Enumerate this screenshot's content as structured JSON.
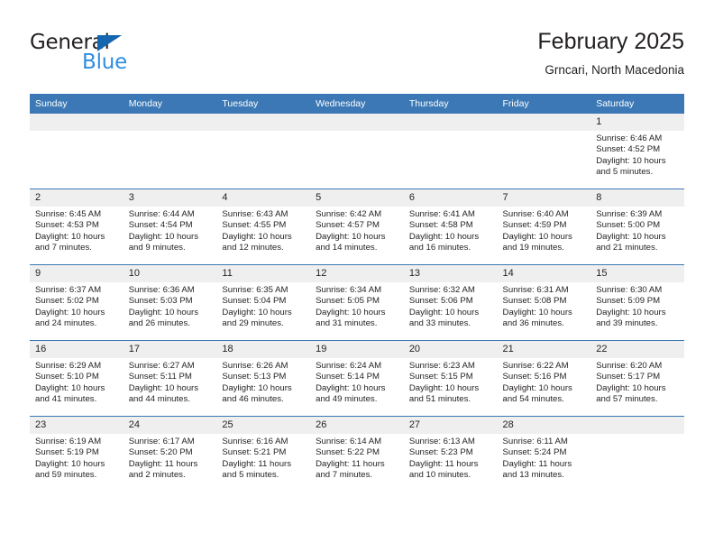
{
  "brand": {
    "name_top": "General",
    "name_bottom": "Blue",
    "accent_color": "#2e8ddf",
    "triangle_color": "#1466b0"
  },
  "header": {
    "title": "February 2025",
    "subtitle": "Grncari, North Macedonia",
    "header_bg": "#3b78b5",
    "daynum_bg": "#efefef"
  },
  "weekday_headers": [
    "Sunday",
    "Monday",
    "Tuesday",
    "Wednesday",
    "Thursday",
    "Friday",
    "Saturday"
  ],
  "labels": {
    "sunrise_prefix": "Sunrise:",
    "sunset_prefix": "Sunset:",
    "daylight_prefix": "Daylight:"
  },
  "weeks": [
    [
      {
        "day": "",
        "blank": true,
        "sunrise": "",
        "sunset": "",
        "daylight_line1": "",
        "daylight_line2": ""
      },
      {
        "day": "",
        "blank": true,
        "sunrise": "",
        "sunset": "",
        "daylight_line1": "",
        "daylight_line2": ""
      },
      {
        "day": "",
        "blank": true,
        "sunrise": "",
        "sunset": "",
        "daylight_line1": "",
        "daylight_line2": ""
      },
      {
        "day": "",
        "blank": true,
        "sunrise": "",
        "sunset": "",
        "daylight_line1": "",
        "daylight_line2": ""
      },
      {
        "day": "",
        "blank": true,
        "sunrise": "",
        "sunset": "",
        "daylight_line1": "",
        "daylight_line2": ""
      },
      {
        "day": "",
        "blank": true,
        "sunrise": "",
        "sunset": "",
        "daylight_line1": "",
        "daylight_line2": ""
      },
      {
        "day": "1",
        "blank": false,
        "sunrise": "Sunrise: 6:46 AM",
        "sunset": "Sunset: 4:52 PM",
        "daylight_line1": "Daylight: 10 hours",
        "daylight_line2": "and 5 minutes."
      }
    ],
    [
      {
        "day": "2",
        "blank": false,
        "sunrise": "Sunrise: 6:45 AM",
        "sunset": "Sunset: 4:53 PM",
        "daylight_line1": "Daylight: 10 hours",
        "daylight_line2": "and 7 minutes."
      },
      {
        "day": "3",
        "blank": false,
        "sunrise": "Sunrise: 6:44 AM",
        "sunset": "Sunset: 4:54 PM",
        "daylight_line1": "Daylight: 10 hours",
        "daylight_line2": "and 9 minutes."
      },
      {
        "day": "4",
        "blank": false,
        "sunrise": "Sunrise: 6:43 AM",
        "sunset": "Sunset: 4:55 PM",
        "daylight_line1": "Daylight: 10 hours",
        "daylight_line2": "and 12 minutes."
      },
      {
        "day": "5",
        "blank": false,
        "sunrise": "Sunrise: 6:42 AM",
        "sunset": "Sunset: 4:57 PM",
        "daylight_line1": "Daylight: 10 hours",
        "daylight_line2": "and 14 minutes."
      },
      {
        "day": "6",
        "blank": false,
        "sunrise": "Sunrise: 6:41 AM",
        "sunset": "Sunset: 4:58 PM",
        "daylight_line1": "Daylight: 10 hours",
        "daylight_line2": "and 16 minutes."
      },
      {
        "day": "7",
        "blank": false,
        "sunrise": "Sunrise: 6:40 AM",
        "sunset": "Sunset: 4:59 PM",
        "daylight_line1": "Daylight: 10 hours",
        "daylight_line2": "and 19 minutes."
      },
      {
        "day": "8",
        "blank": false,
        "sunrise": "Sunrise: 6:39 AM",
        "sunset": "Sunset: 5:00 PM",
        "daylight_line1": "Daylight: 10 hours",
        "daylight_line2": "and 21 minutes."
      }
    ],
    [
      {
        "day": "9",
        "blank": false,
        "sunrise": "Sunrise: 6:37 AM",
        "sunset": "Sunset: 5:02 PM",
        "daylight_line1": "Daylight: 10 hours",
        "daylight_line2": "and 24 minutes."
      },
      {
        "day": "10",
        "blank": false,
        "sunrise": "Sunrise: 6:36 AM",
        "sunset": "Sunset: 5:03 PM",
        "daylight_line1": "Daylight: 10 hours",
        "daylight_line2": "and 26 minutes."
      },
      {
        "day": "11",
        "blank": false,
        "sunrise": "Sunrise: 6:35 AM",
        "sunset": "Sunset: 5:04 PM",
        "daylight_line1": "Daylight: 10 hours",
        "daylight_line2": "and 29 minutes."
      },
      {
        "day": "12",
        "blank": false,
        "sunrise": "Sunrise: 6:34 AM",
        "sunset": "Sunset: 5:05 PM",
        "daylight_line1": "Daylight: 10 hours",
        "daylight_line2": "and 31 minutes."
      },
      {
        "day": "13",
        "blank": false,
        "sunrise": "Sunrise: 6:32 AM",
        "sunset": "Sunset: 5:06 PM",
        "daylight_line1": "Daylight: 10 hours",
        "daylight_line2": "and 33 minutes."
      },
      {
        "day": "14",
        "blank": false,
        "sunrise": "Sunrise: 6:31 AM",
        "sunset": "Sunset: 5:08 PM",
        "daylight_line1": "Daylight: 10 hours",
        "daylight_line2": "and 36 minutes."
      },
      {
        "day": "15",
        "blank": false,
        "sunrise": "Sunrise: 6:30 AM",
        "sunset": "Sunset: 5:09 PM",
        "daylight_line1": "Daylight: 10 hours",
        "daylight_line2": "and 39 minutes."
      }
    ],
    [
      {
        "day": "16",
        "blank": false,
        "sunrise": "Sunrise: 6:29 AM",
        "sunset": "Sunset: 5:10 PM",
        "daylight_line1": "Daylight: 10 hours",
        "daylight_line2": "and 41 minutes."
      },
      {
        "day": "17",
        "blank": false,
        "sunrise": "Sunrise: 6:27 AM",
        "sunset": "Sunset: 5:11 PM",
        "daylight_line1": "Daylight: 10 hours",
        "daylight_line2": "and 44 minutes."
      },
      {
        "day": "18",
        "blank": false,
        "sunrise": "Sunrise: 6:26 AM",
        "sunset": "Sunset: 5:13 PM",
        "daylight_line1": "Daylight: 10 hours",
        "daylight_line2": "and 46 minutes."
      },
      {
        "day": "19",
        "blank": false,
        "sunrise": "Sunrise: 6:24 AM",
        "sunset": "Sunset: 5:14 PM",
        "daylight_line1": "Daylight: 10 hours",
        "daylight_line2": "and 49 minutes."
      },
      {
        "day": "20",
        "blank": false,
        "sunrise": "Sunrise: 6:23 AM",
        "sunset": "Sunset: 5:15 PM",
        "daylight_line1": "Daylight: 10 hours",
        "daylight_line2": "and 51 minutes."
      },
      {
        "day": "21",
        "blank": false,
        "sunrise": "Sunrise: 6:22 AM",
        "sunset": "Sunset: 5:16 PM",
        "daylight_line1": "Daylight: 10 hours",
        "daylight_line2": "and 54 minutes."
      },
      {
        "day": "22",
        "blank": false,
        "sunrise": "Sunrise: 6:20 AM",
        "sunset": "Sunset: 5:17 PM",
        "daylight_line1": "Daylight: 10 hours",
        "daylight_line2": "and 57 minutes."
      }
    ],
    [
      {
        "day": "23",
        "blank": false,
        "sunrise": "Sunrise: 6:19 AM",
        "sunset": "Sunset: 5:19 PM",
        "daylight_line1": "Daylight: 10 hours",
        "daylight_line2": "and 59 minutes."
      },
      {
        "day": "24",
        "blank": false,
        "sunrise": "Sunrise: 6:17 AM",
        "sunset": "Sunset: 5:20 PM",
        "daylight_line1": "Daylight: 11 hours",
        "daylight_line2": "and 2 minutes."
      },
      {
        "day": "25",
        "blank": false,
        "sunrise": "Sunrise: 6:16 AM",
        "sunset": "Sunset: 5:21 PM",
        "daylight_line1": "Daylight: 11 hours",
        "daylight_line2": "and 5 minutes."
      },
      {
        "day": "26",
        "blank": false,
        "sunrise": "Sunrise: 6:14 AM",
        "sunset": "Sunset: 5:22 PM",
        "daylight_line1": "Daylight: 11 hours",
        "daylight_line2": "and 7 minutes."
      },
      {
        "day": "27",
        "blank": false,
        "sunrise": "Sunrise: 6:13 AM",
        "sunset": "Sunset: 5:23 PM",
        "daylight_line1": "Daylight: 11 hours",
        "daylight_line2": "and 10 minutes."
      },
      {
        "day": "28",
        "blank": false,
        "sunrise": "Sunrise: 6:11 AM",
        "sunset": "Sunset: 5:24 PM",
        "daylight_line1": "Daylight: 11 hours",
        "daylight_line2": "and 13 minutes."
      },
      {
        "day": "",
        "blank": true,
        "sunrise": "",
        "sunset": "",
        "daylight_line1": "",
        "daylight_line2": ""
      }
    ]
  ]
}
